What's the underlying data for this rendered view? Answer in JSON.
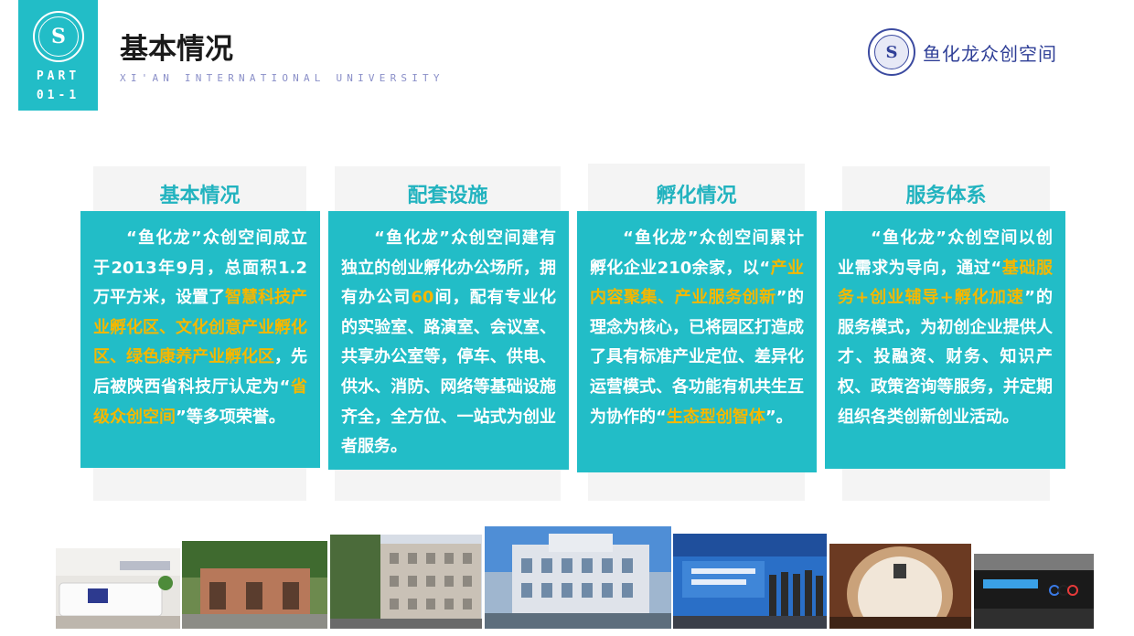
{
  "header": {
    "part_line1": "PART",
    "part_line2": "01-1",
    "title": "基本情况",
    "subtitle": "XI'AN INTERNATIONAL UNIVERSITY",
    "brand_name": "鱼化龙众创空间"
  },
  "icons": {
    "part_logo": "university-emblem-icon",
    "brand_logo": "university-emblem-icon"
  },
  "colors": {
    "accent": "#22bdc7",
    "heading": "#22b3bf",
    "highlight": "#f5b700",
    "brand": "#2f3f97"
  },
  "cards": [
    {
      "heading": "基本情况",
      "segments": [
        {
          "t": "“鱼化龙”众创空间成立于2013年9月，总面积1.2万平方米，设置了",
          "hl": false
        },
        {
          "t": "智慧科技产业孵化区、文化创意产业孵化区、绿色康养产业孵化区",
          "hl": true
        },
        {
          "t": "，先后被陕西省科技厅认定为“",
          "hl": false
        },
        {
          "t": "省级众创空间",
          "hl": true
        },
        {
          "t": "”等多项荣誉。",
          "hl": false
        }
      ]
    },
    {
      "heading": "配套设施",
      "segments": [
        {
          "t": "“鱼化龙”众创空间建有独立的创业孵化办公场所，拥有办公司",
          "hl": false
        },
        {
          "t": "60",
          "hl": true
        },
        {
          "t": "间，配有专业化的实验室、路演室、会议室、共享办公室等，停车、供电、供水、消防、网络等基础设施齐全，全方位、一站式为创业者服务。",
          "hl": false
        }
      ]
    },
    {
      "heading": "孵化情况",
      "segments": [
        {
          "t": "“鱼化龙”众创空间累计孵化企业210余家，以“",
          "hl": false
        },
        {
          "t": "产业内容聚集、产业服务创新",
          "hl": true
        },
        {
          "t": "”的理念为核心，已将园区打造成了具有标准产业定位、差异化运营模式、各功能有机共生互为协作的“",
          "hl": false
        },
        {
          "t": "生态型创智体",
          "hl": true
        },
        {
          "t": "”。",
          "hl": false
        }
      ]
    },
    {
      "heading": "服务体系",
      "segments": [
        {
          "t": "“鱼化龙”众创空间以创业需求为导向，通过“",
          "hl": false
        },
        {
          "t": "基础服务+创业辅导+孵化加速",
          "hl": true
        },
        {
          "t": "”的服务模式，为初创企业提供人才、投融资、财务、知识产权、政策咨询等服务，并定期组织各类创新创业活动。",
          "hl": false
        }
      ]
    }
  ],
  "photos": [
    {
      "name": "reception-desk-photo"
    },
    {
      "name": "campus-street-photo"
    },
    {
      "name": "office-building-photo"
    },
    {
      "name": "main-building-photo"
    },
    {
      "name": "exhibition-visit-photo"
    },
    {
      "name": "lobby-interior-photo"
    },
    {
      "name": "roadshow-hall-photo"
    }
  ]
}
